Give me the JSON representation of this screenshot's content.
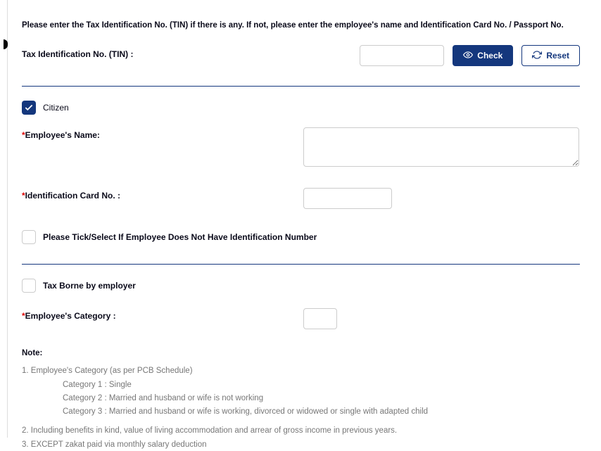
{
  "instruction": "Please enter the Tax Identification No. (TIN) if there is any. If not, please enter the employee's name and Identification Card No. / Passport No.",
  "tin": {
    "label": "Tax Identification No. (TIN) :",
    "value": "",
    "check_label": "Check",
    "reset_label": "Reset"
  },
  "citizen": {
    "label": "Citizen",
    "checked": true
  },
  "employee_name": {
    "label": "Employee's Name:",
    "value": ""
  },
  "id_no": {
    "label": "Identification Card No. :",
    "value": ""
  },
  "no_id": {
    "label": "Please Tick/Select If Employee Does Not Have Identification Number",
    "checked": false
  },
  "tax_borne": {
    "label": "Tax Borne by employer",
    "checked": false
  },
  "category": {
    "label": "Employee's Category :",
    "value": ""
  },
  "note": {
    "head": "Note:",
    "line1_head": "1. Employee's Category (as per PCB Schedule)",
    "cat1": "Category 1 : Single",
    "cat2": "Category 2 : Married and husband or wife is not working",
    "cat3": "Category 3 : Married and husband or wife is working, divorced or widowed or single with adapted child",
    "line2": "2. Including benefits in kind, value of living accommodation and arrear of gross income in previous years.",
    "line3": "3. EXCEPT zakat paid via monthly salary deduction"
  }
}
